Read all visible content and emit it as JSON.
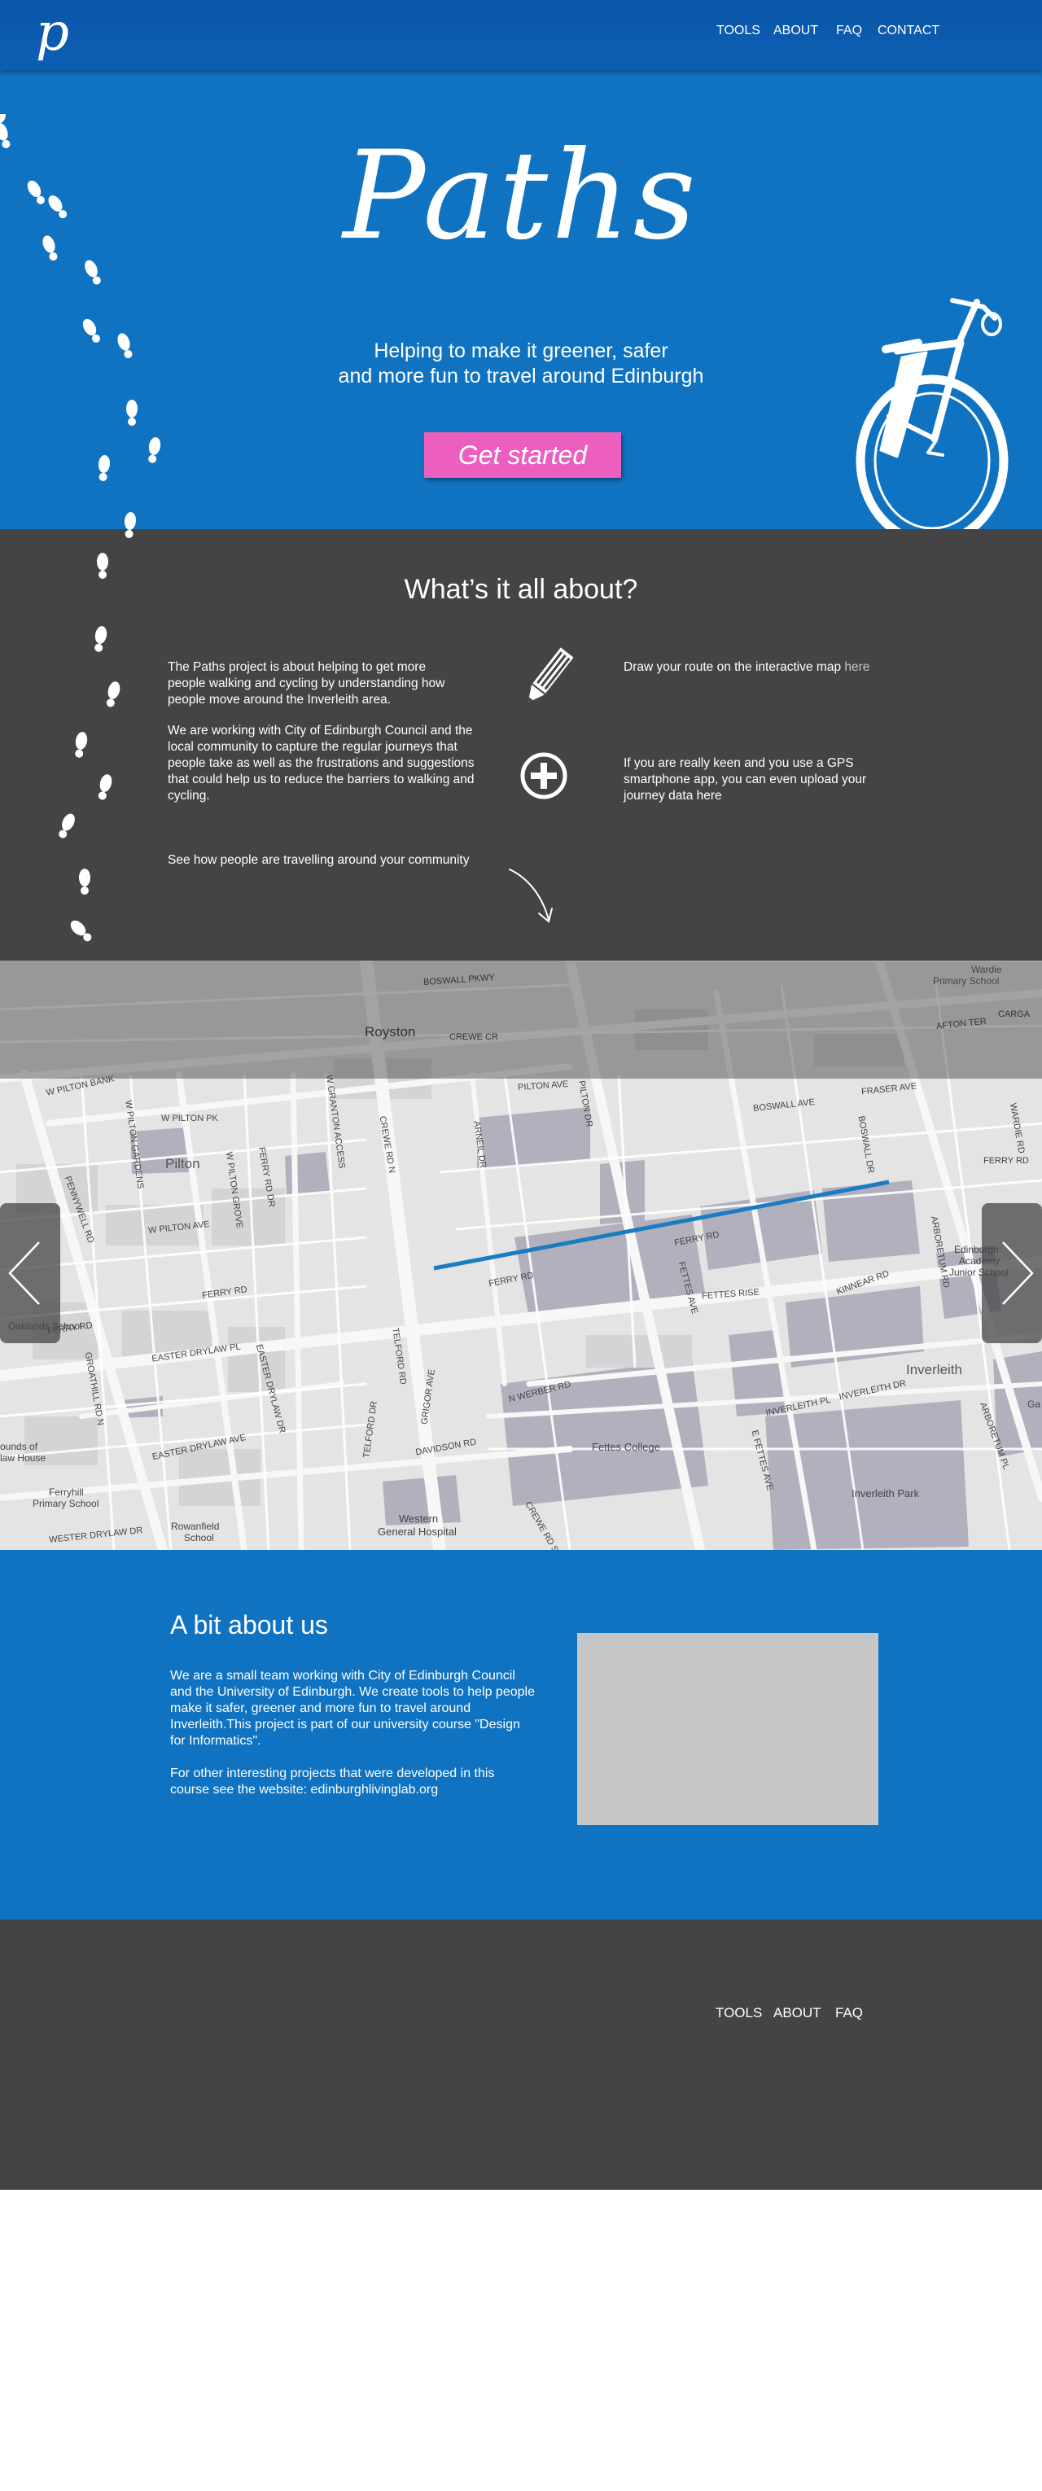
{
  "nav": {
    "logo": "p",
    "links": [
      "TOOLS",
      "ABOUT",
      "FAQ",
      "CONTACT"
    ]
  },
  "hero": {
    "title": "Paths",
    "tagline_line1": "Helping to make it greener, safer",
    "tagline_line2": "and more fun to travel around Edinburgh",
    "cta_label": "Get started",
    "bike_icon": "bicycle-icon"
  },
  "about": {
    "title": "What’s it all about?",
    "para1": "The Paths project is about helping to get more people walking and cycling by understanding how people move around the Inverleith area.",
    "para2": "We are working with City of Edinburgh Council and the local community to capture the regular journeys that people take as well as the frustrations and suggestions that could help us to reduce the barriers to walking and cycling.",
    "para3": "See how people are travelling around your community",
    "draw_text": "Draw your route on the interactive map ",
    "draw_link": "here",
    "upload_text": "If you are really keen and you use a GPS smartphone app, you can even upload your journey data here",
    "icons": [
      "pencil-icon",
      "plus-circle-icon",
      "arrow-down-icon",
      "footprints-icon"
    ]
  },
  "map": {
    "labels": {
      "pilton": "Pilton",
      "royston": "Royston",
      "inverleith": "Inverleith",
      "inverleith_park": "Inverleith Park",
      "fettes_college": "Fettes College",
      "hospital_1": "Western",
      "hospital_2": "General Hospital",
      "ferryhill_1": "Ferryhill",
      "ferryhill_2": "Primary School",
      "rowanfield_1": "Rowanfield",
      "rowanfield_2": "School",
      "oaklands": "Oaklands School",
      "edinburgh_academy_1": "Edinburgh",
      "edinburgh_academy_2": "Academy",
      "edinburgh_academy_3": "Junior School",
      "wardie_1": "Wardie",
      "wardie_2": "Primary School",
      "grounds_1": "ounds of",
      "grounds_2": "law House",
      "ga": "Ga",
      "ferry_rd": "FERRY RD",
      "ferry_rd_2": "FERRY RD",
      "ferry_rd_3": "FERRY RD",
      "ferry_rd_4": "FERRY RD",
      "ferry_rd_5": "FERRY RD",
      "ferry_rd_dr": "FERRY RD DR",
      "pilton_ave": "PILTON AVE",
      "pilton_dr": "PILTON DR",
      "w_pilton_ave": "W PILTON AVE",
      "w_pilton_pk": "W PILTON PK",
      "w_pilton_gardens": "W PILTON GARDENS",
      "w_pilton_grove": "W PILTON GROVE",
      "w_pilton_bank": "W PILTON BANK",
      "boswall_ave": "BOSWALL AVE",
      "boswall_dr": "BOSWALL DR",
      "boswall_pkwy": "BOSWALL PKWY",
      "fraser_ave": "FRASER AVE",
      "wardie_rd": "WARDIE RD",
      "crewe_rd_n": "CREWE RD N",
      "crewe_rd_s": "CREWE RD S",
      "crewe_cr": "CREWE CR",
      "granton_access": "W GRANTON ACCESS",
      "arnel_dr": "ARNEIL DR",
      "fettes_ave": "FETTES AVE",
      "e_fettes_ave": "E FETTES AVE",
      "fettes_rise": "FETTES RISE",
      "kinnear_rd": "KINNEAR RD",
      "arboretum_rd": "ARBORETUM RD",
      "arboretum_pl": "ARBORETUM PL",
      "n_werber_rd": "N WERBER RD",
      "davidson_rd": "DAVIDSON RD",
      "telford_rd": "TELFORD RD",
      "telford_dr": "TELFORD DR",
      "groathill_rd_n": "GROATHILL RD N",
      "pennywell_rd": "PENNYWELL RD",
      "easter_drylaw_pl": "EASTER DRYLAW PL",
      "easter_drylaw_ave": "EASTER DRYLAW AVE",
      "easter_drylaw_dr": "EASTER DRYLAW DR",
      "western_drylaw_dr": "WESTER DRYLAW DR",
      "inverleith_pl": "INVERLEITH PL",
      "inverleith_dr": "INVERLEITH DR",
      "grigor_ave": "GRIGOR AVE",
      "afton_ter": "AFTON TER",
      "carga": "CARGA"
    },
    "route_color": "#1a7cc1",
    "prev_icon": "chevron-left-icon",
    "next_icon": "chevron-right-icon"
  },
  "us": {
    "title": "A bit about us",
    "para1": "We are a small team working with City of Edinburgh Council and the University of Edinburgh. We create tools to help people make it safer, greener and more fun to travel around Inverleith.This project is part of our university course \"Design for Informatics\".",
    "para2": "For other interesting projects that were developed in this course see the website: edinburghlivinglab.org"
  },
  "footer": {
    "links": [
      "TOOLS",
      "ABOUT",
      "FAQ"
    ]
  },
  "colors": {
    "brand_blue": "#0f73c2",
    "nav_blue": "#0a56a8",
    "dark_grey": "#444346",
    "cta_pink": "#ec5fbf",
    "placeholder_grey": "#c6c6c8"
  }
}
